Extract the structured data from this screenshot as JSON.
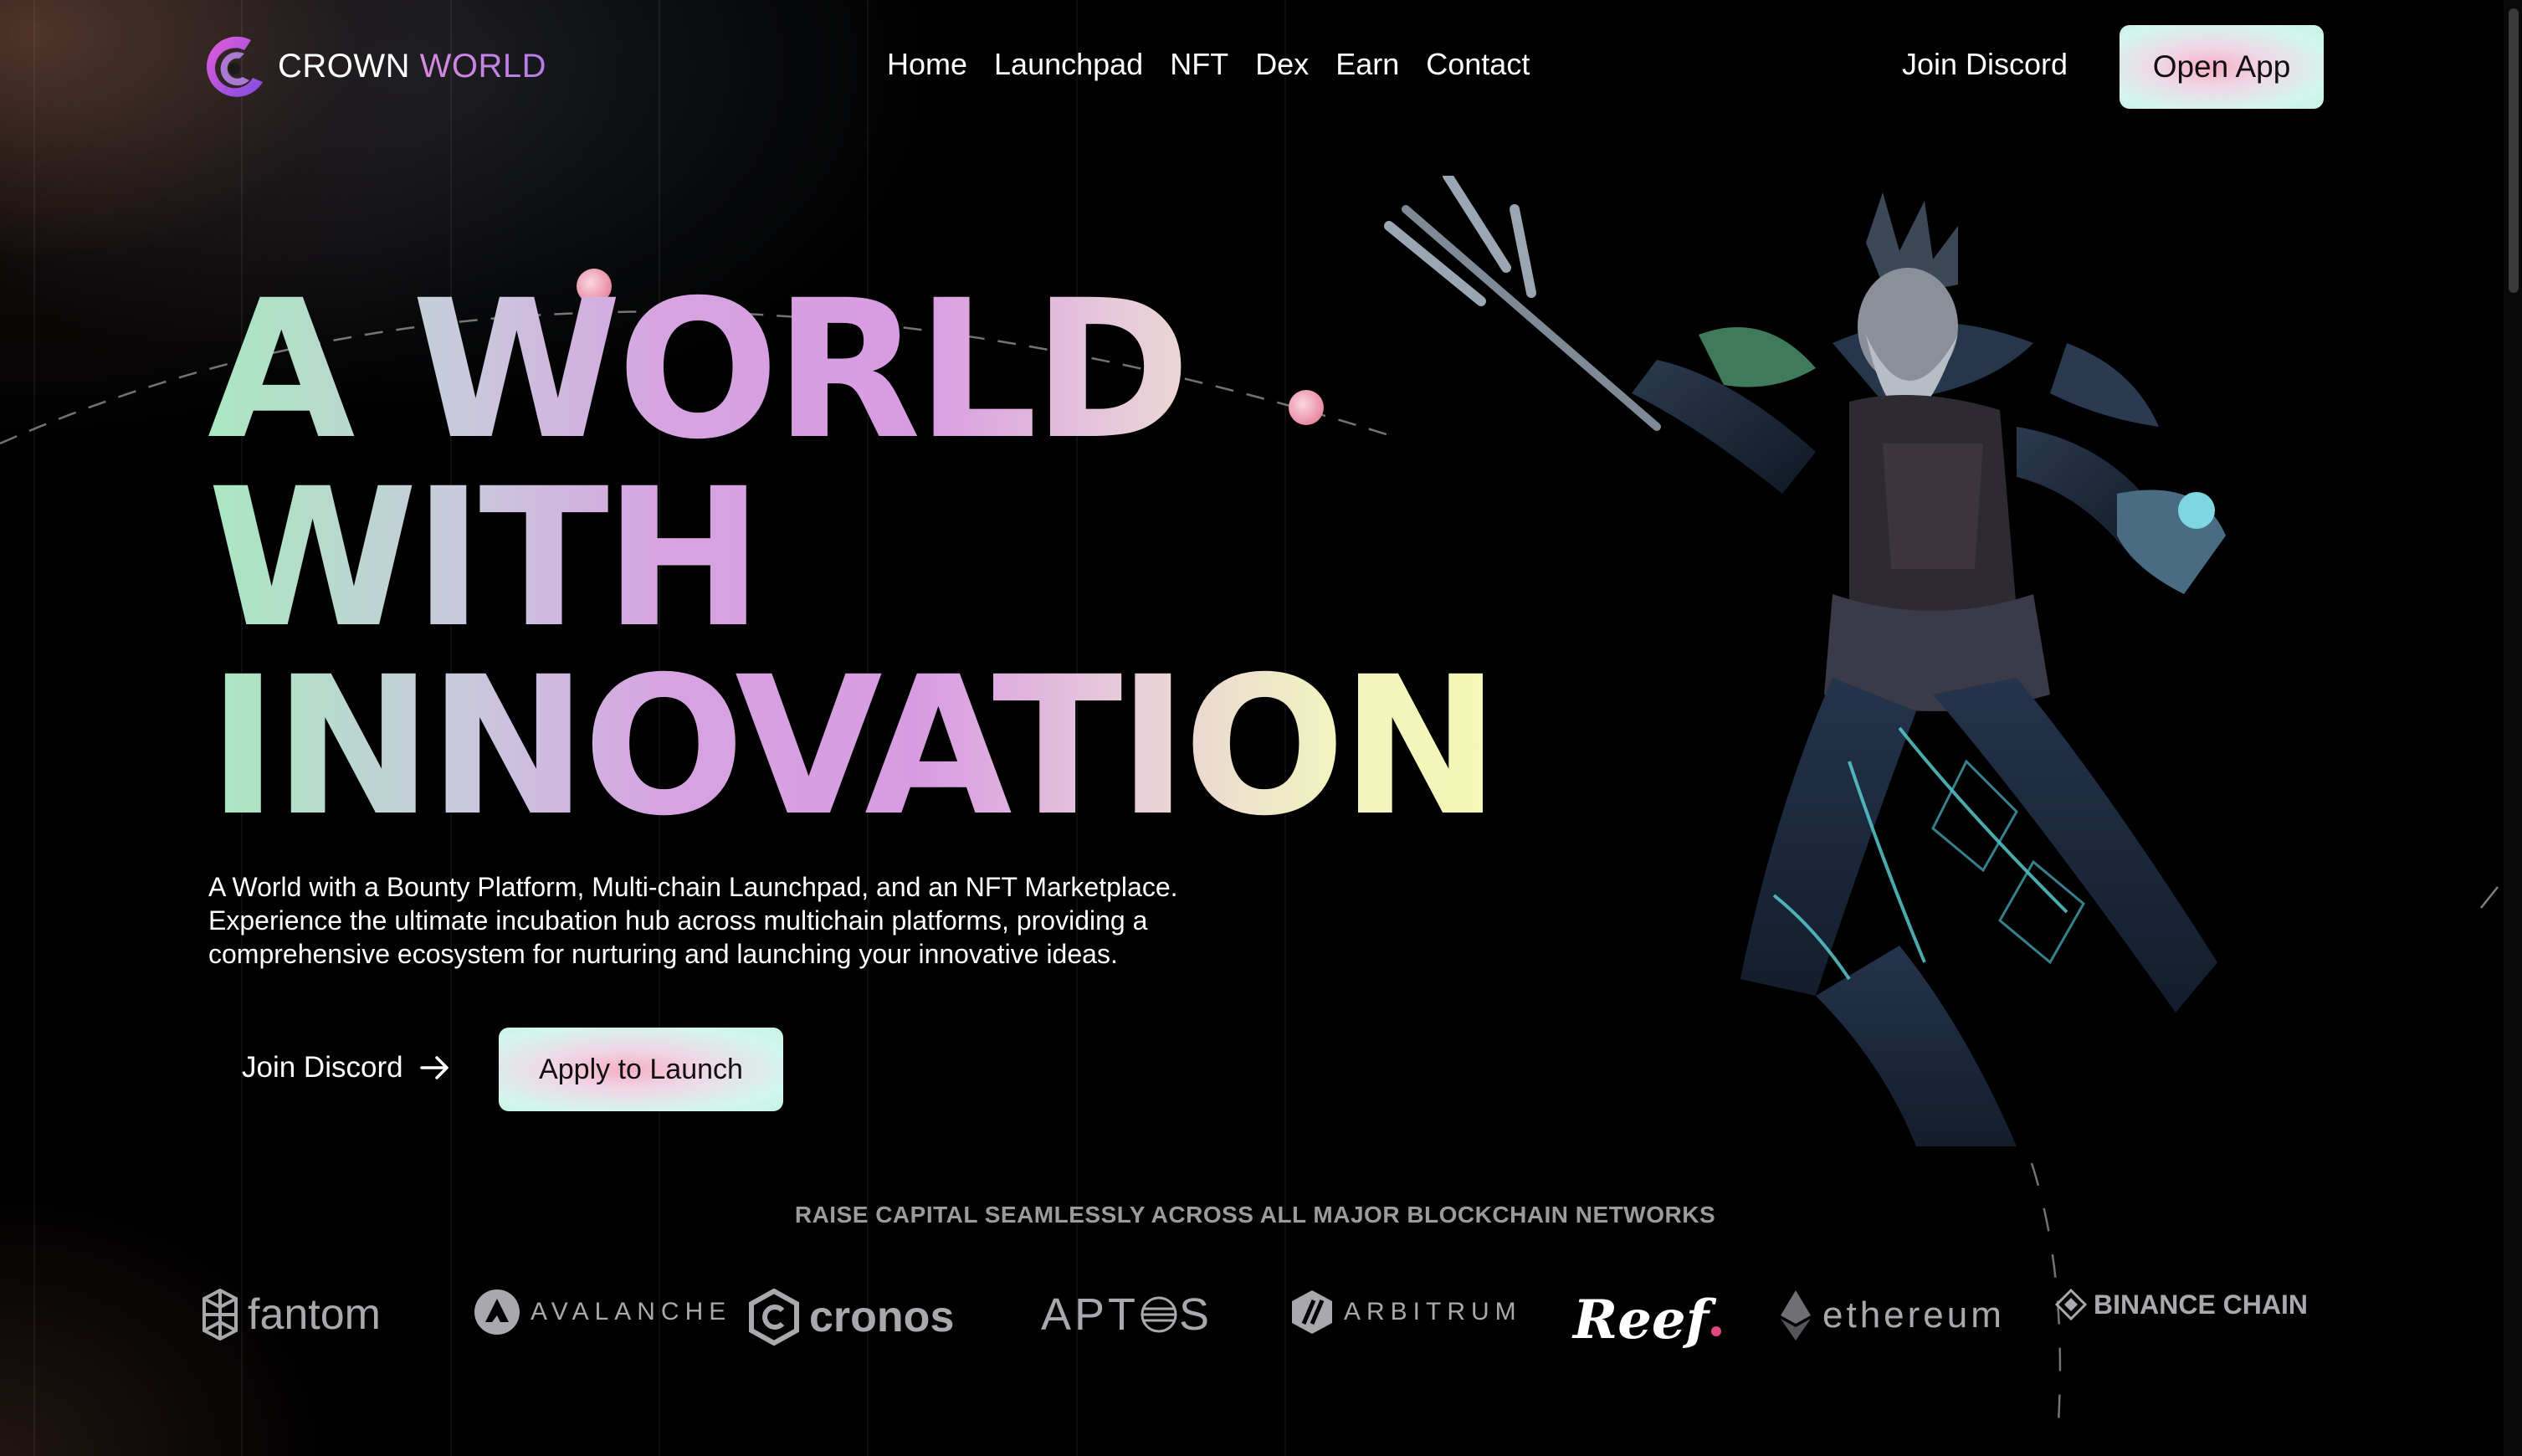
{
  "brand": {
    "name_part1": "CROWN",
    "name_part2": "WORLD"
  },
  "nav": {
    "items": [
      "Home",
      "Launchpad",
      "NFT",
      "Dex",
      "Earn",
      "Contact"
    ]
  },
  "header": {
    "discord_label": "Join Discord",
    "open_app_label": "Open App"
  },
  "hero": {
    "title_lines": [
      "A WORLD",
      "WITH",
      "INNOVATION"
    ],
    "description_lines": [
      "A World with a Bounty Platform, Multi-chain Launchpad, and an NFT Marketplace.",
      "Experience the ultimate incubation hub across multichain platforms, providing a",
      "comprehensive ecosystem for nurturing and launching your innovative ideas."
    ],
    "discord_cta": "Join Discord",
    "apply_cta": "Apply to Launch"
  },
  "chains": {
    "title": "RAISE CAPITAL SEAMLESSLY ACROSS ALL MAJOR BLOCKCHAIN NETWORKS",
    "logos": [
      "fantom",
      "AVALANCHE",
      "cronos",
      "APT",
      "S",
      "ARBITRUM",
      "Reef",
      "ethereum",
      "BINANCE CHAIN"
    ]
  },
  "colors": {
    "accent_mint": "#c8f2e6",
    "accent_pink": "#f7b0c6",
    "background": "#000000"
  }
}
